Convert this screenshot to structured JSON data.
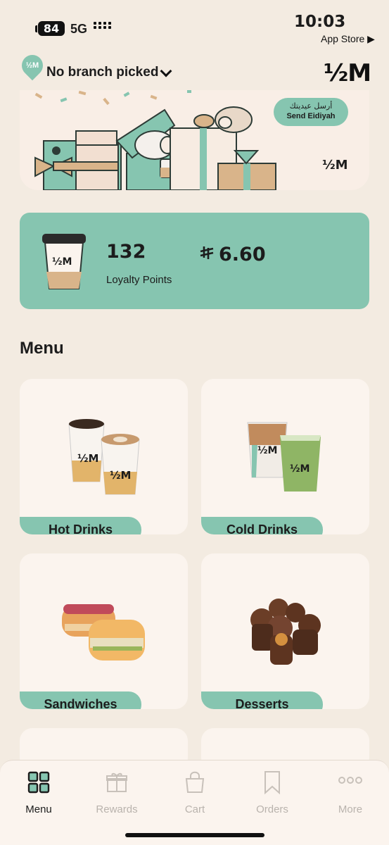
{
  "status_bar": {
    "battery": "84",
    "network": "5G",
    "time": "10:03",
    "back_app": "App Store ▶"
  },
  "header": {
    "branch_icon_text": "½M",
    "branch_label": "No branch picked",
    "logo": "½M"
  },
  "banner": {
    "button_ar": "أرسل عيديتك",
    "button_en": "Send Eidiyah",
    "logo": "½M"
  },
  "loyalty": {
    "cup_label": "½M",
    "points": "132",
    "points_label": "Loyalty Points",
    "currency_icon": "riyal-icon",
    "balance": "6.60"
  },
  "menu": {
    "title": "Menu",
    "categories": [
      {
        "label": "Hot Drinks"
      },
      {
        "label": "Cold Drinks"
      },
      {
        "label": "Sandwiches"
      },
      {
        "label": "Desserts"
      }
    ],
    "cup_label": "½M"
  },
  "tabs": [
    {
      "label": "Menu",
      "icon": "grid-icon",
      "active": true
    },
    {
      "label": "Rewards",
      "icon": "gift-icon",
      "active": false
    },
    {
      "label": "Cart",
      "icon": "bag-icon",
      "active": false
    },
    {
      "label": "Orders",
      "icon": "bookmark-icon",
      "active": false
    },
    {
      "label": "More",
      "icon": "dots-icon",
      "active": false
    }
  ],
  "colors": {
    "accent": "#86c5b0",
    "background": "#f3ebe1",
    "card": "#fbf4ee"
  }
}
